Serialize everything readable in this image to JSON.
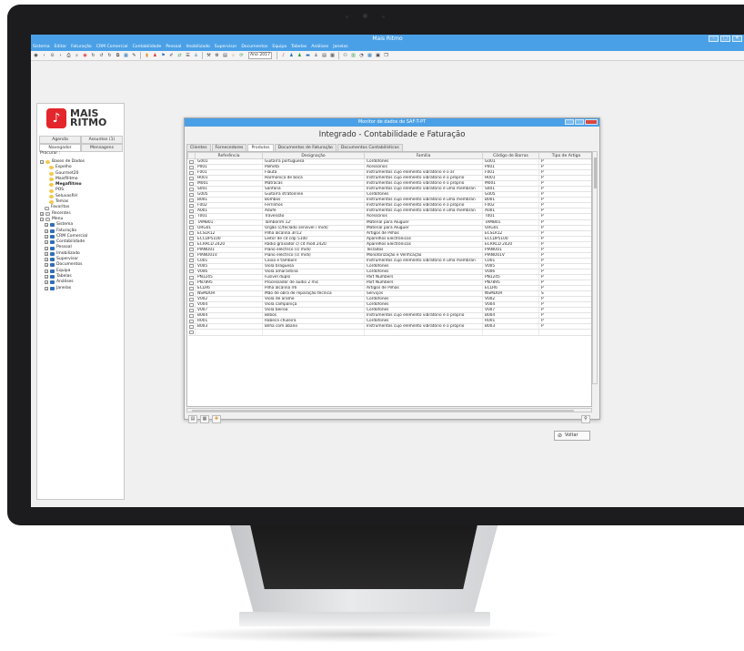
{
  "app": {
    "title": "Mais Ritmo",
    "window_controls": [
      "–",
      "□",
      "✕"
    ]
  },
  "menu": [
    "Sistema",
    "Editar",
    "Faturação",
    "CRM Comercial",
    "Contabilidade",
    "Pessoal",
    "Imobilizado",
    "Supervisor",
    "Documentos",
    "Equipa",
    "Tabelas",
    "Análises",
    "Janelas"
  ],
  "toolbar": {
    "year_label": "Ano 2017"
  },
  "logo": {
    "mark": "♪",
    "line1": "MAIS",
    "line2": "RITMO"
  },
  "left_panel": {
    "tabs_row1": [
      "Agenda",
      "Assuntos (1)"
    ],
    "tabs_row2": [
      "Navegador",
      "Mensagens"
    ],
    "search_label": "Procurar :",
    "tree": [
      {
        "label": "Bases de Dados",
        "level": 0,
        "kind": "db-root",
        "exp": "−"
      },
      {
        "label": "Espelho",
        "level": 2,
        "kind": "db"
      },
      {
        "label": "Gourmet20",
        "level": 2,
        "kind": "db"
      },
      {
        "label": "Maisfilitmo",
        "level": 2,
        "kind": "db"
      },
      {
        "label": "Megaflitmo",
        "level": 2,
        "kind": "db",
        "bold": true
      },
      {
        "label": "POS",
        "level": 2,
        "kind": "db"
      },
      {
        "label": "SeluvasRH",
        "level": 2,
        "kind": "db"
      },
      {
        "label": "Temas",
        "level": 2,
        "kind": "db"
      },
      {
        "label": "Favoritos",
        "level": 1,
        "kind": "fav"
      },
      {
        "label": "Recentes",
        "level": 0,
        "kind": "fav",
        "exp": "+"
      },
      {
        "label": "Menu",
        "level": 0,
        "kind": "fav",
        "exp": "−"
      },
      {
        "label": "Sistema",
        "level": 1,
        "kind": "folder",
        "exp": "+"
      },
      {
        "label": "Faturação",
        "level": 1,
        "kind": "folder",
        "exp": "+"
      },
      {
        "label": "CRM Comercial",
        "level": 1,
        "kind": "folder",
        "exp": "+"
      },
      {
        "label": "Contabilidade",
        "level": 1,
        "kind": "folder",
        "exp": "+"
      },
      {
        "label": "Pessoal",
        "level": 1,
        "kind": "folder",
        "exp": "+"
      },
      {
        "label": "Imobilizado",
        "level": 1,
        "kind": "folder",
        "exp": "+"
      },
      {
        "label": "Supervisor",
        "level": 1,
        "kind": "folder",
        "exp": "+"
      },
      {
        "label": "Documentos",
        "level": 1,
        "kind": "folder",
        "exp": "+"
      },
      {
        "label": "Equipa",
        "level": 1,
        "kind": "folder",
        "exp": "+"
      },
      {
        "label": "Tabelas",
        "level": 1,
        "kind": "folder",
        "exp": "+"
      },
      {
        "label": "Análises",
        "level": 1,
        "kind": "folder",
        "exp": "+"
      },
      {
        "label": "Janelas",
        "level": 1,
        "kind": "folder",
        "exp": "+"
      }
    ]
  },
  "dialog": {
    "title": "Monitor de dados do SAF-T-PT",
    "heading": "Integrado - Contabilidade e Faturação",
    "tabs": [
      "Clientes",
      "Fornecedores",
      "Produtos",
      "Documentos de Faturação",
      "Documentos Contabilísticos"
    ],
    "active_tab": 2,
    "columns": [
      "",
      "Referência",
      "Designação",
      "Família",
      "Código de Barras",
      "Tipo de Artigo"
    ],
    "rows": [
      [
        "G001",
        "Guitarra portuguesa",
        "Cordofones",
        "G001",
        "P"
      ],
      [
        "P001",
        "Palheta",
        "Acessórios",
        "P001",
        "P"
      ],
      [
        "F001",
        "Flauta",
        "Instrumentos cujo elemento vibratório é o ar",
        "F001",
        "P"
      ],
      [
        "H001",
        "Harmónica de boca",
        "Instrumentos cujo elemento vibratório é o próprio",
        "H001",
        "P"
      ],
      [
        "M001",
        "Matracas",
        "Instrumentos cujo elemento vibratório é o próprio",
        "M001",
        "P"
      ],
      [
        "S001",
        "Sanfona",
        "Instrumentos cujo elemento vibratório é uma membran",
        "S001",
        "P"
      ],
      [
        "G005",
        "Guitarra stratonline",
        "Cordofones",
        "G005",
        "P"
      ],
      [
        "B001",
        "Bombos",
        "Instrumentos cujo elemento vibratório é uma membran",
        "B001",
        "P"
      ],
      [
        "F002",
        "Ferrinhos",
        "Instrumentos cujo elemento vibratório é o próprio",
        "F002",
        "P"
      ],
      [
        "A001",
        "Adufe",
        "Instrumentos cujo elemento vibratório é uma membran",
        "A001",
        "P"
      ],
      [
        "T001",
        "Travessão",
        "Acessórios",
        "T001",
        "P"
      ],
      [
        "TAMB01",
        "Tamborim 12'",
        "Material para Aluguer",
        "TAMB01",
        "P"
      ],
      [
        "ORG01",
        "Órgão (c/teclado sensível / midi)",
        "Material para Aluguer",
        "ORG01",
        "P"
      ],
      [
        "ECSLR12",
        "Pilha alcalina 3lr12",
        "Artigos de Pilhas",
        "ECSLR12",
        "P"
      ],
      [
        "ECCDP5100",
        "Leitor de cd cdp 5100",
        "Aparelhos Electrónicos",
        "ECCDP5100",
        "P"
      ],
      [
        "ECRRCD 2420",
        "Rádio gravador c/ cd mod 2420",
        "Aparelhos Electrónicos",
        "ECRRCD 2420",
        "P"
      ],
      [
        "PIANO01",
        "Piano eléctrico (c/ midi)",
        "Teclados",
        "PIANO01",
        "P"
      ],
      [
        "PIANO01V",
        "Piano eléctrico (c/ midi)",
        "Monotorização e Verificação",
        "PIANO01V",
        "P"
      ],
      [
        "C001",
        "Caixa e tamboril",
        "Instrumentos cujo elemento vibratório é uma membran",
        "C001",
        "P"
      ],
      [
        "V005",
        "Viola braguesa",
        "Cordofones",
        "V005",
        "P"
      ],
      [
        "V006",
        "Viola amarantina",
        "Cordofones",
        "V006",
        "P"
      ],
      [
        "PN1245",
        "Fusível duplo",
        "Part Numbers",
        "PN1245",
        "P"
      ],
      [
        "PN7895",
        "Processador de audio 2 mic",
        "Part Numbers",
        "PN7895",
        "P"
      ],
      [
        "ECLR6",
        "Pilha alcalina lr6",
        "Artigos de Pilhas",
        "ECLR6",
        "P"
      ],
      [
        "NSMDOR",
        "Mão de obra de reparação técnica",
        "Serviços",
        "NSMDOR",
        "S"
      ],
      [
        "V002",
        "Viola de arame",
        "Cordofones",
        "V002",
        "P"
      ],
      [
        "V004",
        "Viola campaniça",
        "Cordofones",
        "V004",
        "P"
      ],
      [
        "V007",
        "Viola beiroa",
        "Cordofones",
        "V007",
        "P"
      ],
      [
        "B004",
        "Bilbos",
        "Instrumentos cujo elemento vibratório é o próprio",
        "B004",
        "P"
      ],
      [
        "R001",
        "Rabeca chuleira",
        "Cordofones",
        "R001",
        "P"
      ],
      [
        "B003",
        "Bilha com abano",
        "Instrumentos cujo elemento vibratório é o próprio",
        "B003",
        "P"
      ],
      [
        "",
        "",
        "",
        "",
        ""
      ]
    ],
    "search_icon": "⚲",
    "voltar_label": "Voltar"
  }
}
